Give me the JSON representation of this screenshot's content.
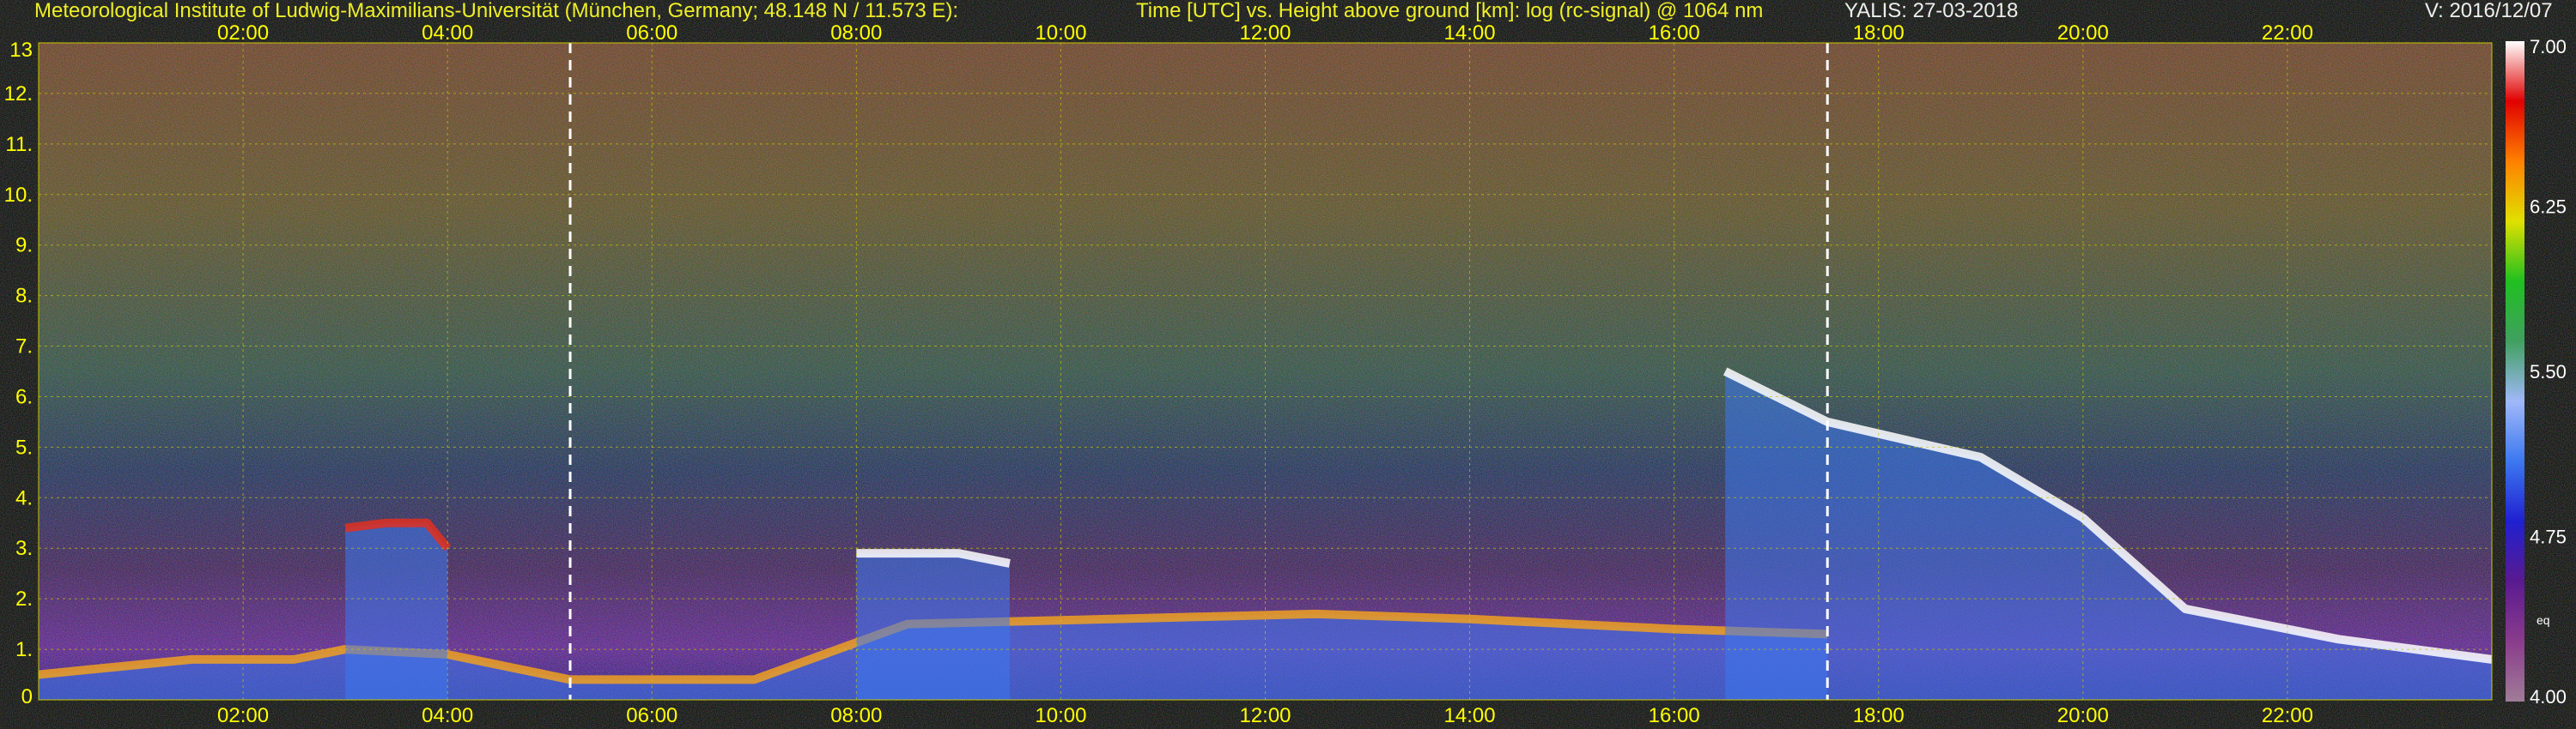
{
  "header": {
    "institute": "Meteorological Institute of Ludwig-Maximilians-Universität (München, Germany; 48.148 N / 11.573 E):",
    "plot_title": "Time [UTC] vs. Height above ground [km]: log (rc-signal) @ 1064 nm",
    "instrument_date": "YALIS: 27-03-2018",
    "version": "V: 2016/12/07"
  },
  "colors": {
    "background": "#000000",
    "tick_text": "#ffff00",
    "header_white": "#ffffff",
    "grid": "#c8c800",
    "marker": "#ffffff"
  },
  "chart_data": {
    "type": "heatmap",
    "title": "Time [UTC] vs. Height above ground [km]: log (rc-signal) @ 1064 nm",
    "x_axis": {
      "label": "Time [UTC]",
      "range_hours": [
        0.0,
        24.0
      ],
      "tick_hours": [
        2,
        4,
        6,
        8,
        10,
        12,
        14,
        16,
        18,
        20,
        22
      ],
      "tick_labels": [
        "02:00",
        "04:00",
        "06:00",
        "08:00",
        "10:00",
        "12:00",
        "14:00",
        "16:00",
        "18:00",
        "20:00",
        "22:00"
      ]
    },
    "y_axis": {
      "label": "Height above ground [km]",
      "range": [
        0,
        13
      ],
      "tick_values": [
        0,
        1,
        2,
        3,
        4,
        5,
        6,
        7,
        8,
        9,
        10,
        11,
        12,
        13
      ],
      "tick_labels": [
        "0",
        "1.",
        "2.",
        "3.",
        "4.",
        "5.",
        "6.",
        "7.",
        "8.",
        "9.",
        "10.",
        "11.",
        "12.",
        "13"
      ]
    },
    "grid": true,
    "vertical_markers_hours": [
      5.2,
      17.5
    ],
    "colorbar": {
      "range": [
        4.0,
        7.0
      ],
      "tick_values": [
        4.0,
        4.75,
        5.5,
        6.25,
        7.0
      ],
      "tick_labels": [
        "4.00",
        "4.75",
        "5.50",
        "6.25",
        "7.00"
      ],
      "extra_label": "eq",
      "colors": [
        "#a07c98",
        "#8a3c8c",
        "#5a1a90",
        "#2020d0",
        "#3c78f0",
        "#a0b8f8",
        "#40a060",
        "#20c020",
        "#e0e000",
        "#ff8000",
        "#e00000",
        "#ffffff"
      ]
    },
    "features": [
      {
        "kind": "boundary-layer",
        "t_hours": [
          0.0,
          0.5,
          1.5,
          2.5,
          3.0,
          4.0,
          5.2,
          7.0,
          8.5,
          10.5,
          12.5,
          14.0,
          16.0,
          17.5
        ],
        "top_km": [
          0.5,
          0.6,
          0.8,
          0.8,
          1.0,
          0.9,
          0.4,
          0.4,
          1.5,
          1.6,
          1.7,
          1.6,
          1.4,
          1.3
        ]
      },
      {
        "kind": "aerosol-plume",
        "t_hours": [
          3.0,
          3.4,
          3.8,
          4.0
        ],
        "top_km": [
          3.4,
          3.5,
          3.5,
          3.0
        ]
      },
      {
        "kind": "cloud",
        "t_hours": [
          8.0,
          9.0,
          9.5
        ],
        "top_km": [
          2.9,
          2.9,
          2.7
        ]
      },
      {
        "kind": "cloud",
        "t_hours": [
          16.5,
          17.5,
          19.0,
          20.0,
          21.0,
          22.5,
          24.0
        ],
        "top_km": [
          6.5,
          5.5,
          4.8,
          3.6,
          1.8,
          1.2,
          0.8
        ]
      }
    ]
  }
}
